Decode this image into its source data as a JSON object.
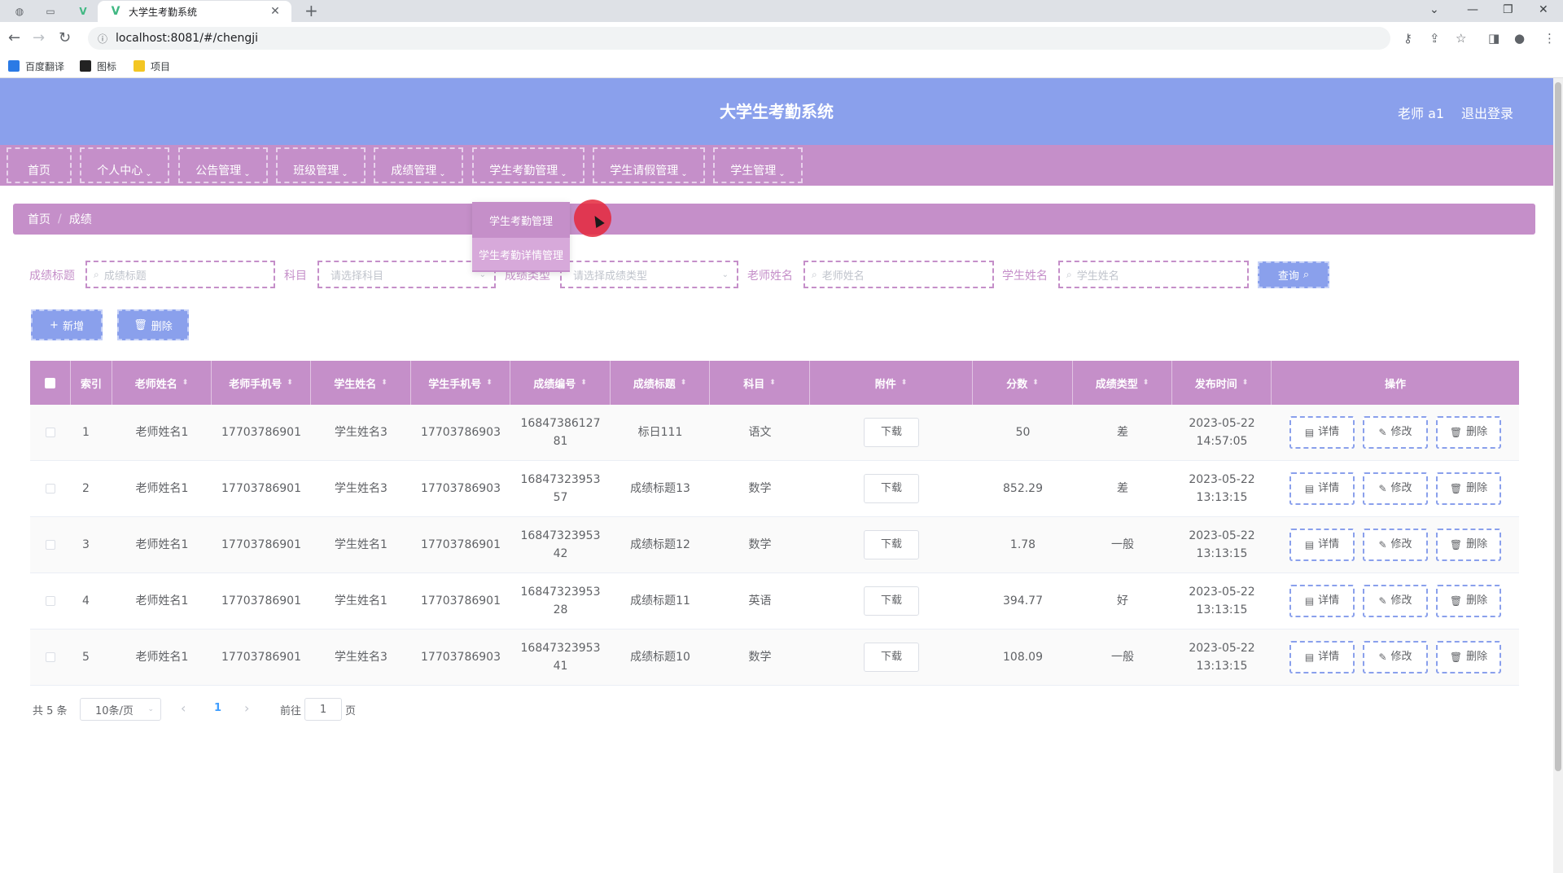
{
  "browser": {
    "tab_title": "大学生考勤系统",
    "url": "localhost:8081/#/chengji",
    "bookmarks": [
      {
        "label": "百度翻译",
        "color": "#2b7ae5"
      },
      {
        "label": "图标",
        "color": "#222222"
      },
      {
        "label": "项目",
        "color": "#f3c623"
      }
    ]
  },
  "header": {
    "title": "大学生考勤系统",
    "user": "老师 a1",
    "logout": "退出登录"
  },
  "nav": {
    "items": [
      "首页",
      "个人中心",
      "公告管理",
      "班级管理",
      "成绩管理",
      "学生考勤管理",
      "学生请假管理",
      "学生管理"
    ],
    "dropdown": [
      "学生考勤管理",
      "学生考勤详情管理"
    ]
  },
  "breadcrumb": [
    "首页",
    "成绩"
  ],
  "search": {
    "title_label": "成绩标题",
    "title_placeholder": "成绩标题",
    "subject_label": "科目",
    "subject_placeholder": "请选择科目",
    "type_label": "成绩类型",
    "type_placeholder": "请选择成绩类型",
    "teacher_label": "老师姓名",
    "teacher_placeholder": "老师姓名",
    "student_label": "学生姓名",
    "student_placeholder": "学生姓名",
    "query_button": "查询"
  },
  "actions": {
    "add": "新增",
    "delete": "删除"
  },
  "table": {
    "columns": [
      "索引",
      "老师姓名",
      "老师手机号",
      "学生姓名",
      "学生手机号",
      "成绩编号",
      "成绩标题",
      "科目",
      "附件",
      "分数",
      "成绩类型",
      "发布时间",
      "操作"
    ],
    "download_label": "下载",
    "op_labels": {
      "detail": "详情",
      "edit": "修改",
      "delete": "删除"
    },
    "rows": [
      {
        "index": "1",
        "teacher": "老师姓名1",
        "teacher_phone": "17703786901",
        "student": "学生姓名3",
        "student_phone": "17703786903",
        "code": "1684738612781",
        "title": "标日111",
        "subject": "语文",
        "score": "50",
        "type": "差",
        "time": "2023-05-22 14:57:05"
      },
      {
        "index": "2",
        "teacher": "老师姓名1",
        "teacher_phone": "17703786901",
        "student": "学生姓名3",
        "student_phone": "17703786903",
        "code": "1684732395357",
        "title": "成绩标题13",
        "subject": "数学",
        "score": "852.29",
        "type": "差",
        "time": "2023-05-22 13:13:15"
      },
      {
        "index": "3",
        "teacher": "老师姓名1",
        "teacher_phone": "17703786901",
        "student": "学生姓名1",
        "student_phone": "17703786901",
        "code": "1684732395342",
        "title": "成绩标题12",
        "subject": "数学",
        "score": "1.78",
        "type": "一般",
        "time": "2023-05-22 13:13:15"
      },
      {
        "index": "4",
        "teacher": "老师姓名1",
        "teacher_phone": "17703786901",
        "student": "学生姓名1",
        "student_phone": "17703786901",
        "code": "1684732395328",
        "title": "成绩标题11",
        "subject": "英语",
        "score": "394.77",
        "type": "好",
        "time": "2023-05-22 13:13:15"
      },
      {
        "index": "5",
        "teacher": "老师姓名1",
        "teacher_phone": "17703786901",
        "student": "学生姓名3",
        "student_phone": "17703786903",
        "code": "1684732395341",
        "title": "成绩标题10",
        "subject": "数学",
        "score": "108.09",
        "type": "一般",
        "time": "2023-05-22 13:13:15"
      }
    ]
  },
  "pagination": {
    "total": "共 5 条",
    "page_size": "10条/页",
    "prev": "‹",
    "current": "1",
    "next": "›",
    "goto_label": "前往",
    "goto_value": "1",
    "page_suffix": "页"
  },
  "colors": {
    "header": "#8aa0ec",
    "nav": "#c58fc9",
    "accent": "#8aa0ec"
  }
}
